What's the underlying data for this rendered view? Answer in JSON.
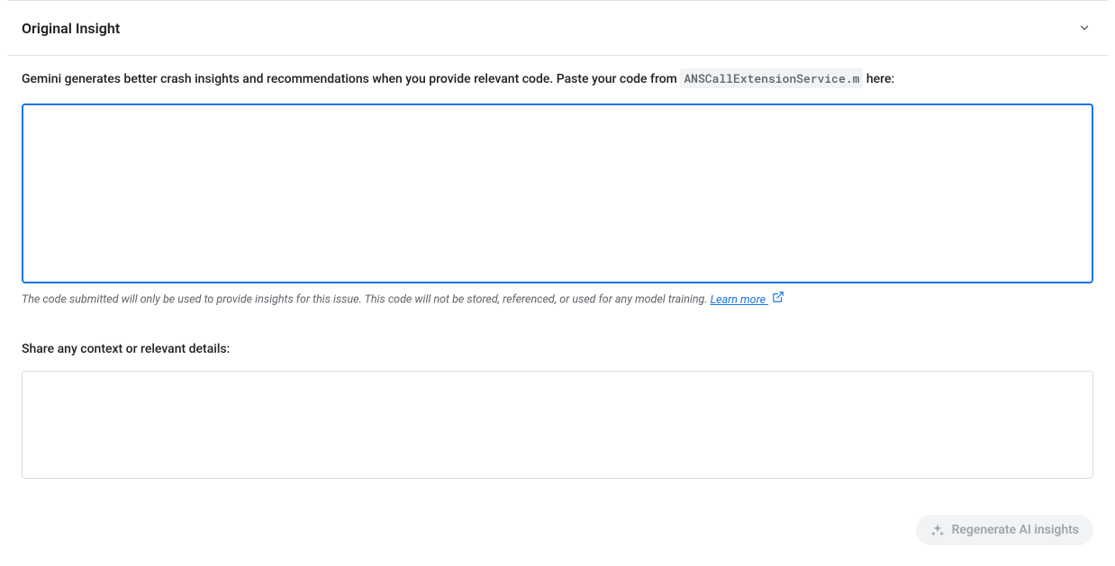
{
  "accordion": {
    "title": "Original Insight"
  },
  "codeSection": {
    "intro_prefix": "Gemini generates better crash insights and recommendations when you provide relevant code. Paste your code from ",
    "filename": "ANSCallExtensionService.m",
    "intro_suffix": " here:",
    "code_value": "",
    "disclaimer_text": "The code submitted will only be used to provide insights for this issue. This code will not be stored, referenced, or used for any model training. ",
    "learn_more_label": "Learn more "
  },
  "contextSection": {
    "label": "Share any context or relevant details:",
    "context_value": ""
  },
  "actions": {
    "regenerate_label": "Regenerate AI insights"
  }
}
